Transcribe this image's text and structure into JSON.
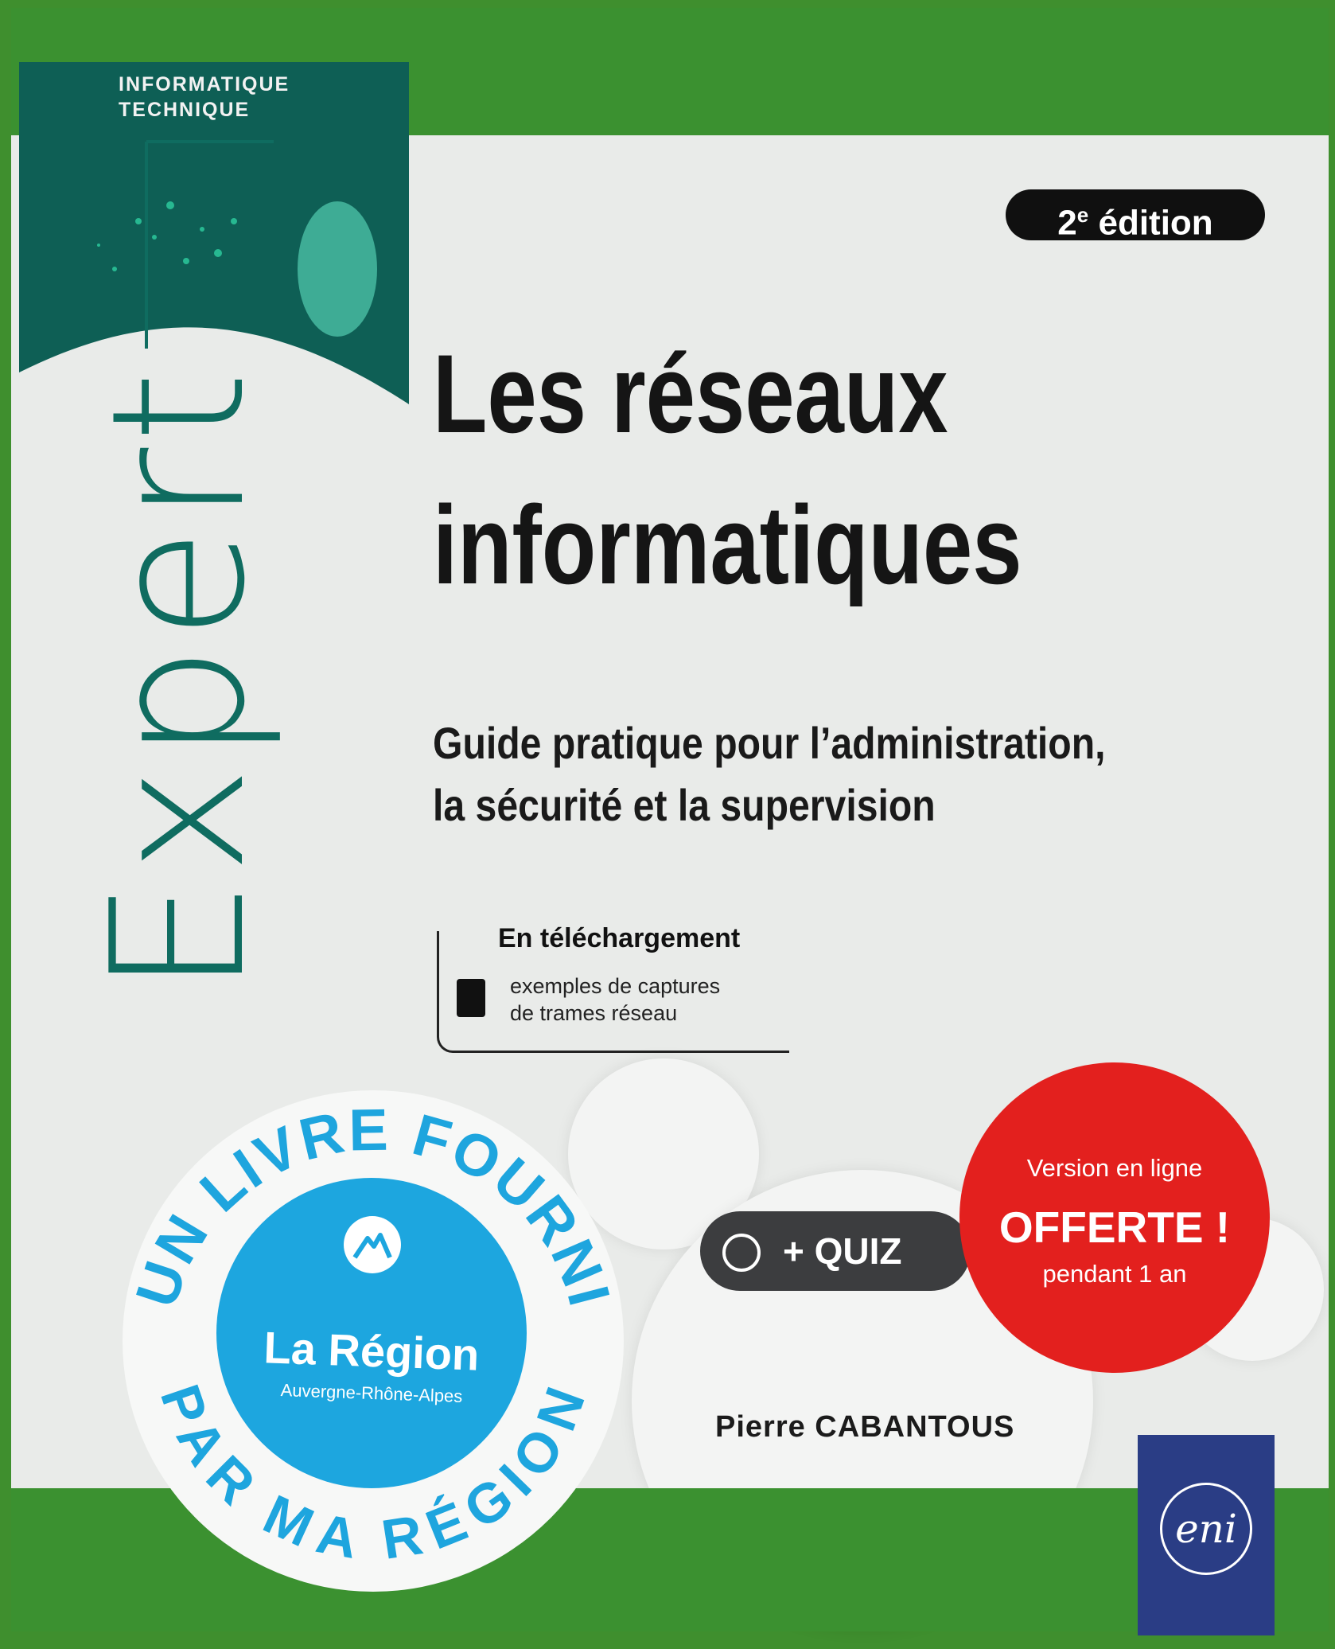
{
  "series": {
    "line1": "INFORMATIQUE",
    "line2": "TECHNIQUE"
  },
  "edition": {
    "number": "2",
    "suffix": "e",
    "label": "édition"
  },
  "collection": "Expert",
  "title": {
    "line1": "Les réseaux",
    "line2": "informatiques"
  },
  "subtitle": {
    "line1": "Guide pratique pour l’administration,",
    "line2": "la sécurité et la supervision"
  },
  "download": {
    "title": "En téléchargement",
    "line1": "exemples de captures",
    "line2": "de trames réseau"
  },
  "quiz": {
    "label": "+ QUIZ"
  },
  "online_badge": {
    "line1": "Version en ligne",
    "line2": "OFFERTE !",
    "line3": "pendant 1 an"
  },
  "region_seal": {
    "top_arc": "UN LIVRE FOURNI",
    "bottom_arc": "PAR MA RÉGION",
    "name": "La Région",
    "subname": "Auvergne-Rhône-Alpes"
  },
  "author": "Pierre CABANTOUS",
  "publisher": "eni",
  "colors": {
    "green": "#3b9130",
    "teal": "#0f6c60",
    "red": "#e3201e",
    "region_blue": "#1da6df",
    "publisher_blue": "#2a3d85"
  }
}
